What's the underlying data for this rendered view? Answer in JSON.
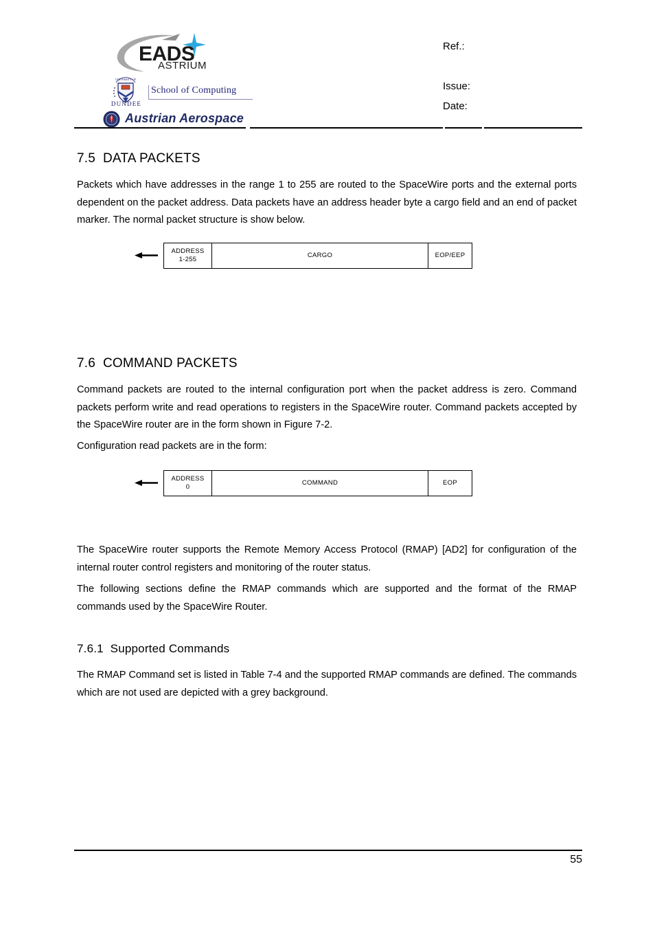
{
  "document": {
    "page_number": "55"
  },
  "header": {
    "logos": {
      "eads": {
        "main": "EADS",
        "sub": "ASTRIUM"
      },
      "dundee": {
        "crest_top": "UNIVERSITY OF",
        "crest_bottom": "DUNDEE",
        "school": "School of Computing"
      },
      "austrian": {
        "name": "Austrian Aerospace"
      }
    },
    "meta": {
      "ref_label": "Ref.:",
      "ref_value": "",
      "issue_label": "Issue:",
      "issue_value": "",
      "date_label": "Date:",
      "date_value": ""
    }
  },
  "sections": {
    "data_packets": {
      "heading": "7.5  DATA PACKETS",
      "paragraph": "Packets which have addresses in the range 1 to 255 are routed to the SpaceWire ports and the external ports dependent on the packet address.  Data packets have an address header byte a cargo field and an end of packet marker.  The normal packet structure is show below.",
      "diagram": {
        "arrow": "left-arrow",
        "cells": [
          {
            "line1": "ADDRESS",
            "line2": "1-255"
          },
          {
            "line1": "CARGO",
            "line2": ""
          },
          {
            "line1": "EOP/EEP",
            "line2": ""
          }
        ]
      }
    },
    "command_packets": {
      "heading": "7.6  COMMAND PACKETS",
      "paragraph1": "Command packets are routed to the internal configuration port when the packet address is zero. Command packets perform write and read operations to registers in the SpaceWire router. Command packets accepted by the SpaceWire router are in the form shown in Figure 7-2.",
      "paragraph2": "Configuration read packets are in the form:",
      "diagram": {
        "arrow": "left-arrow",
        "cells": [
          {
            "line1": "ADDRESS",
            "line2": "0"
          },
          {
            "line1": "COMMAND",
            "line2": ""
          },
          {
            "line1": "EOP",
            "line2": ""
          }
        ]
      },
      "paragraph3": "The SpaceWire router supports the Remote Memory Access Protocol (RMAP) [AD2] for configuration of the internal router control registers and monitoring of the router status.",
      "paragraph4": "The following sections define the RMAP commands which are supported and the format of the RMAP commands used by the SpaceWire Router."
    },
    "supported_commands": {
      "heading": "7.6.1  Supported Commands",
      "paragraph": "The RMAP Command set is listed in Table 7-4 and the supported RMAP commands are defined. The commands which are not used are depicted with a grey background."
    }
  },
  "colors": {
    "text": "#000000",
    "dundee_blue": "#24247a",
    "austrian_navy": "#1f2a63",
    "eads_swoosh_grey": "#9a9a9a",
    "eads_star_blue": "#2aa8e0"
  }
}
